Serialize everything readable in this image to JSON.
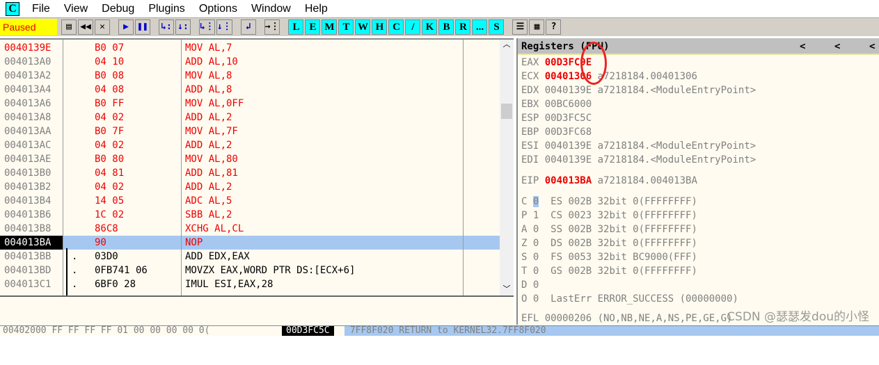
{
  "menu": {
    "logo": "C",
    "items": [
      "File",
      "View",
      "Debug",
      "Plugins",
      "Options",
      "Window",
      "Help"
    ]
  },
  "toolbar": {
    "status": "Paused",
    "buttons": [
      "L",
      "E",
      "M",
      "T",
      "W",
      "H",
      "C",
      "/",
      "K",
      "B",
      "R",
      "...",
      "S"
    ]
  },
  "disasm": [
    {
      "addr": "0040139E",
      "hex": "B0 07",
      "ins": "MOV AL,7",
      "addr_red": true,
      "red": true
    },
    {
      "addr": "004013A0",
      "hex": "04 10",
      "ins": "ADD AL,10",
      "red": true
    },
    {
      "addr": "004013A2",
      "hex": "B0 08",
      "ins": "MOV AL,8",
      "red": true
    },
    {
      "addr": "004013A4",
      "hex": "04 08",
      "ins": "ADD AL,8",
      "red": true
    },
    {
      "addr": "004013A6",
      "hex": "B0 FF",
      "ins": "MOV AL,0FF",
      "red": true
    },
    {
      "addr": "004013A8",
      "hex": "04 02",
      "ins": "ADD AL,2",
      "red": true
    },
    {
      "addr": "004013AA",
      "hex": "B0 7F",
      "ins": "MOV AL,7F",
      "red": true
    },
    {
      "addr": "004013AC",
      "hex": "04 02",
      "ins": "ADD AL,2",
      "red": true
    },
    {
      "addr": "004013AE",
      "hex": "B0 80",
      "ins": "MOV AL,80",
      "red": true
    },
    {
      "addr": "004013B0",
      "hex": "04 81",
      "ins": "ADD AL,81",
      "red": true
    },
    {
      "addr": "004013B2",
      "hex": "04 02",
      "ins": "ADD AL,2",
      "red": true
    },
    {
      "addr": "004013B4",
      "hex": "14 05",
      "ins": "ADC AL,5",
      "red": true
    },
    {
      "addr": "004013B6",
      "hex": "1C 02",
      "ins": "SBB AL,2",
      "red": true
    },
    {
      "addr": "004013B8",
      "hex": "86C8",
      "ins": "XCHG AL,CL",
      "red": true
    },
    {
      "addr": "004013BA",
      "hex": "90",
      "ins": "NOP",
      "red": true,
      "selected": true
    },
    {
      "addr": "004013BB",
      "mark": ".",
      "hex": "03D0",
      "ins": "ADD EDX,EAX"
    },
    {
      "addr": "004013BD",
      "mark": ".",
      "hex": "0FB741 06",
      "ins": "MOVZX EAX,WORD PTR DS:[ECX+6]"
    },
    {
      "addr": "004013C1",
      "mark": ".",
      "hex": "6BF0 28",
      "ins": "IMUL ESI,EAX,28"
    }
  ],
  "registers": {
    "title": "Registers (FPU)",
    "lines": [
      {
        "name": "EAX",
        "val": "00D3FC9E",
        "red": true,
        "note": ""
      },
      {
        "name": "ECX",
        "val": "00401306",
        "red": true,
        "note": "a7218184.00401306"
      },
      {
        "name": "EDX",
        "val": "0040139E",
        "note": "a7218184.<ModuleEntryPoint>"
      },
      {
        "name": "EBX",
        "val": "00BC6000",
        "note": ""
      },
      {
        "name": "ESP",
        "val": "00D3FC5C",
        "note": ""
      },
      {
        "name": "EBP",
        "val": "00D3FC68",
        "note": ""
      },
      {
        "name": "ESI",
        "val": "0040139E",
        "note": "a7218184.<ModuleEntryPoint>"
      },
      {
        "name": "EDI",
        "val": "0040139E",
        "note": "a7218184.<ModuleEntryPoint>"
      },
      {
        "name": "EIP",
        "val": "004013BA",
        "red": true,
        "note": "a7218184.004013BA"
      }
    ],
    "flags": [
      {
        "f": "C",
        "v": "0",
        "seg": "ES 002B 32bit 0(FFFFFFFF)"
      },
      {
        "f": "P",
        "v": "1",
        "seg": "CS 0023 32bit 0(FFFFFFFF)"
      },
      {
        "f": "A",
        "v": "0",
        "seg": "SS 002B 32bit 0(FFFFFFFF)"
      },
      {
        "f": "Z",
        "v": "0",
        "seg": "DS 002B 32bit 0(FFFFFFFF)"
      },
      {
        "f": "S",
        "v": "0",
        "seg": "FS 0053 32bit BC9000(FFF)"
      },
      {
        "f": "T",
        "v": "0",
        "seg": "GS 002B 32bit 0(FFFFFFFF)"
      },
      {
        "f": "D",
        "v": "0",
        "seg": ""
      },
      {
        "f": "O",
        "v": "0",
        "seg": "LastErr ERROR_SUCCESS (00000000)"
      }
    ],
    "efl": "EFL 00000206 (NO,NB,NE,A,NS,PE,GE,G)"
  },
  "bottom": {
    "dump": "00402000 FF FF FF FF 01 00 00 00 00 0(",
    "stack_addr": "00D3FC5C",
    "stack": " 7FF8F020 RETURN to KERNEL32.7FF8F020"
  },
  "watermark": "CSDN @瑟瑟发dou的小怪"
}
